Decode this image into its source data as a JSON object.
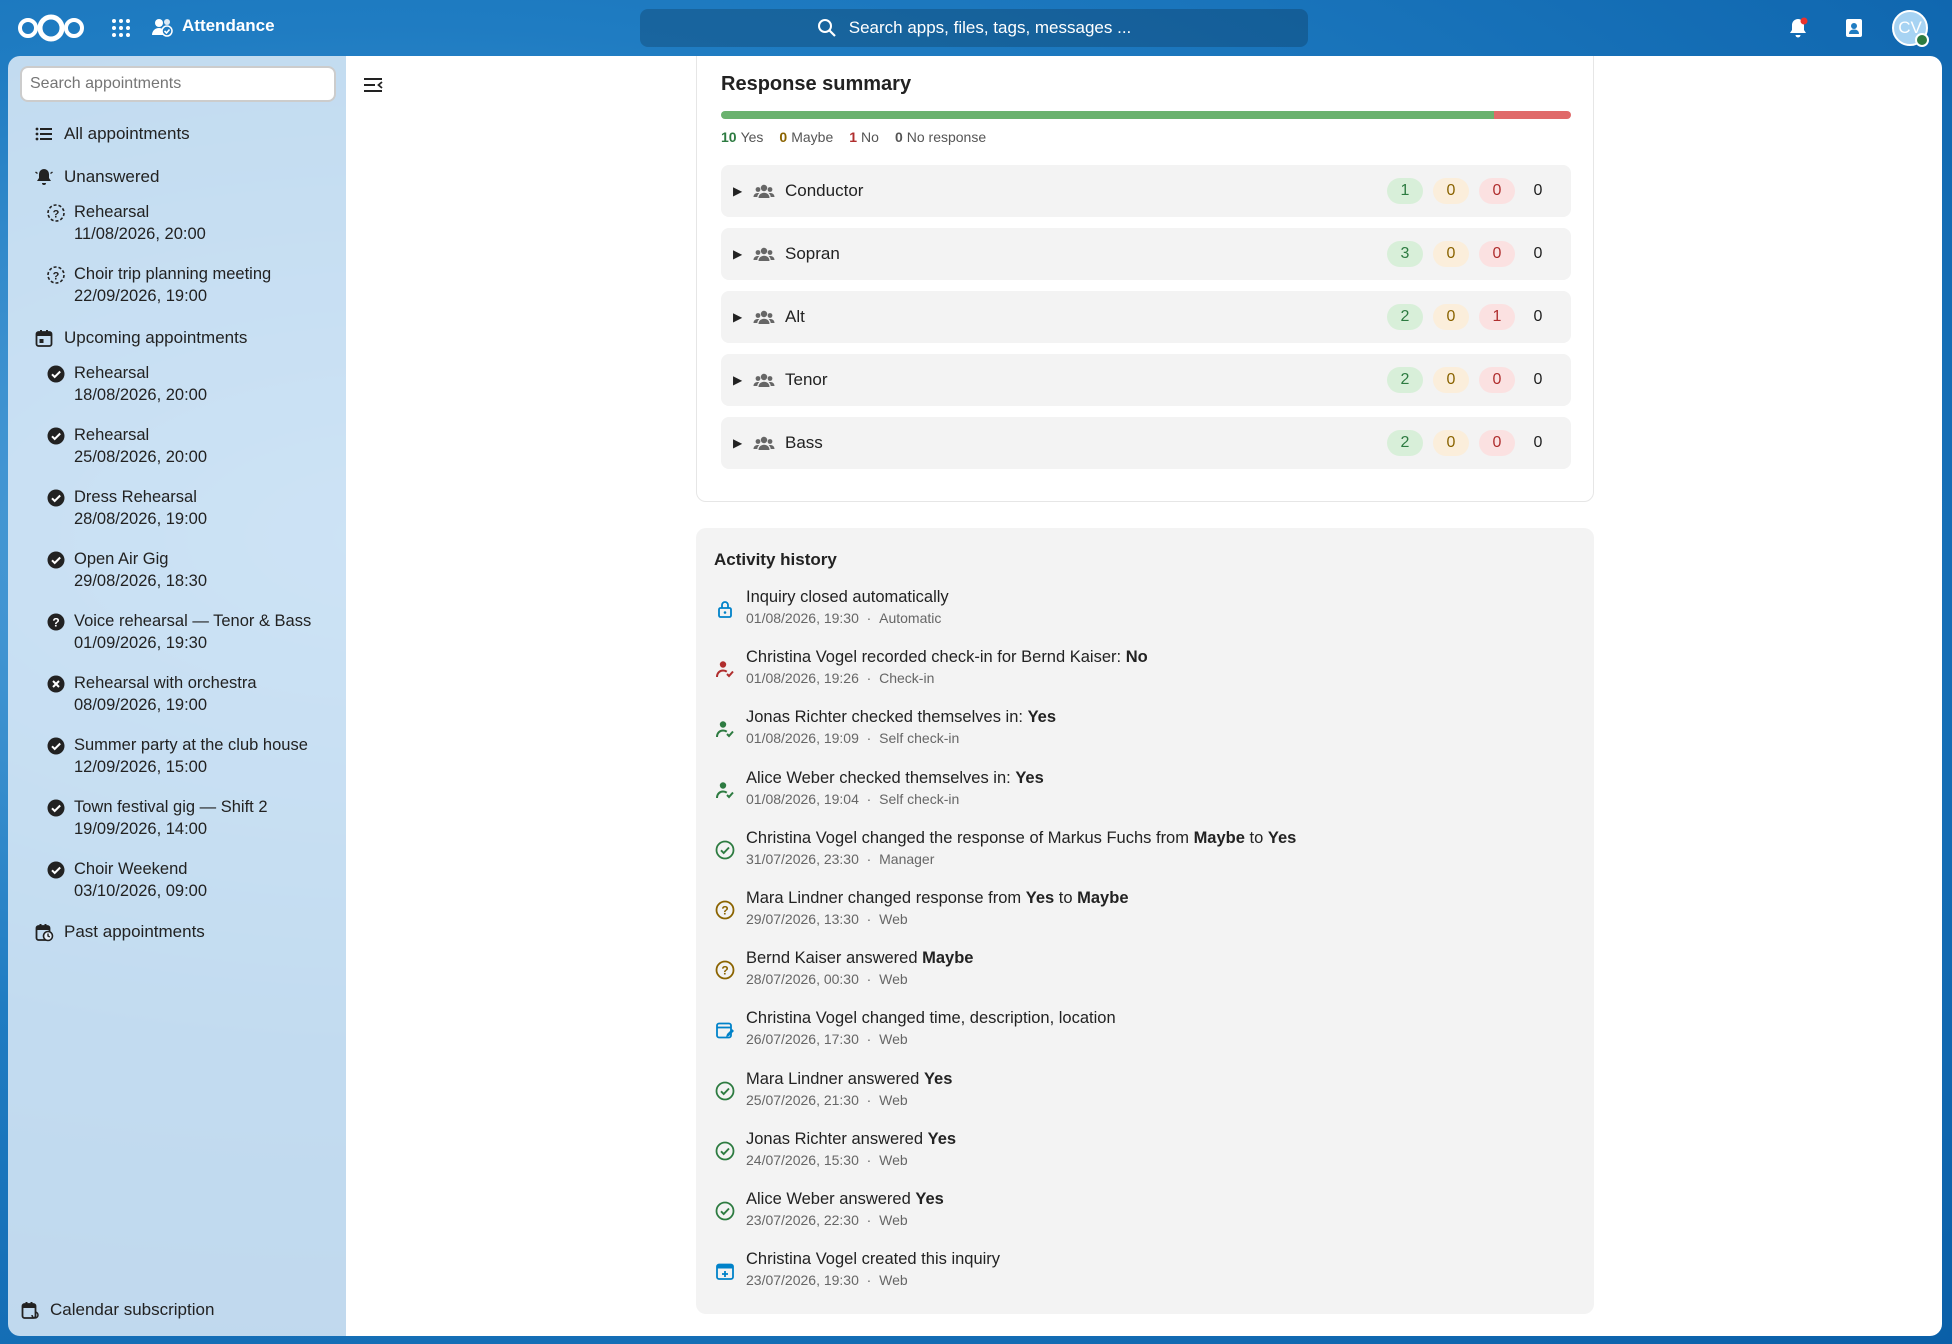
{
  "header": {
    "app_name": "Attendance",
    "search_placeholder": "Search apps, files, tags, messages ...",
    "avatar_initials": "CV"
  },
  "sidebar": {
    "search_placeholder": "Search appointments",
    "all_label": "All appointments",
    "unanswered_label": "Unanswered",
    "unanswered": [
      {
        "title": "Rehearsal",
        "date": "11/08/2026, 20:00"
      },
      {
        "title": "Choir trip planning meeting",
        "date": "22/09/2026, 19:00"
      }
    ],
    "upcoming_label": "Upcoming appointments",
    "upcoming": [
      {
        "title": "Rehearsal",
        "date": "18/08/2026, 20:00",
        "status": "yes"
      },
      {
        "title": "Rehearsal",
        "date": "25/08/2026, 20:00",
        "status": "yes"
      },
      {
        "title": "Dress Rehearsal",
        "date": "28/08/2026, 19:00",
        "status": "yes"
      },
      {
        "title": "Open Air Gig",
        "date": "29/08/2026, 18:30",
        "status": "yes"
      },
      {
        "title": "Voice rehearsal — Tenor & Bass",
        "date": "01/09/2026, 19:30",
        "status": "maybe"
      },
      {
        "title": "Rehearsal with orchestra",
        "date": "08/09/2026, 19:00",
        "status": "no"
      },
      {
        "title": "Summer party at the club house",
        "date": "12/09/2026, 15:00",
        "status": "yes"
      },
      {
        "title": "Town festival gig — Shift 2",
        "date": "19/09/2026, 14:00",
        "status": "yes"
      },
      {
        "title": "Choir Weekend",
        "date": "03/10/2026, 09:00",
        "status": "yes"
      }
    ],
    "past_label": "Past appointments",
    "footer_label": "Calendar subscription"
  },
  "summary": {
    "title": "Response summary",
    "counts": {
      "yes": "10",
      "maybe": "0",
      "no": "1",
      "none": "0"
    },
    "labels": {
      "yes": "Yes",
      "maybe": "Maybe",
      "no": "No",
      "none": "No response"
    },
    "yes_fraction": 0.909,
    "groups": [
      {
        "name": "Conductor",
        "yes": "1",
        "maybe": "0",
        "no": "0",
        "none": "0"
      },
      {
        "name": "Sopran",
        "yes": "3",
        "maybe": "0",
        "no": "0",
        "none": "0"
      },
      {
        "name": "Alt",
        "yes": "2",
        "maybe": "0",
        "no": "1",
        "none": "0"
      },
      {
        "name": "Tenor",
        "yes": "2",
        "maybe": "0",
        "no": "0",
        "none": "0"
      },
      {
        "name": "Bass",
        "yes": "2",
        "maybe": "0",
        "no": "0",
        "none": "0"
      }
    ]
  },
  "activity": {
    "title": "Activity history",
    "items": [
      {
        "icon": "lock-icon",
        "text": "Inquiry closed automatically",
        "bold": "",
        "date": "01/08/2026, 19:30",
        "source": "Automatic"
      },
      {
        "icon": "checkin-no-icon",
        "text": "Christina Vogel recorded check-in for Bernd Kaiser: ",
        "bold": "No",
        "date": "01/08/2026, 19:26",
        "source": "Check-in"
      },
      {
        "icon": "checkin-yes-icon",
        "text": "Jonas Richter checked themselves in: ",
        "bold": "Yes",
        "date": "01/08/2026, 19:09",
        "source": "Self check-in"
      },
      {
        "icon": "checkin-yes-icon",
        "text": "Alice Weber checked themselves in: ",
        "bold": "Yes",
        "date": "01/08/2026, 19:04",
        "source": "Self check-in"
      },
      {
        "icon": "check-circle-icon",
        "text": "Christina Vogel changed the response of Markus Fuchs from ",
        "bold": "Maybe",
        "text2": " to ",
        "bold2": "Yes",
        "date": "31/07/2026, 23:30",
        "source": "Manager"
      },
      {
        "icon": "question-circle-icon",
        "text": "Mara Lindner changed response from ",
        "bold": "Yes",
        "text2": " to ",
        "bold2": "Maybe",
        "date": "29/07/2026, 13:30",
        "source": "Web"
      },
      {
        "icon": "question-circle-icon",
        "text": "Bernd Kaiser answered ",
        "bold": "Maybe",
        "date": "28/07/2026, 00:30",
        "source": "Web"
      },
      {
        "icon": "calendar-edit-icon",
        "text": "Christina Vogel changed time, description, location",
        "bold": "",
        "date": "26/07/2026, 17:30",
        "source": "Web"
      },
      {
        "icon": "check-circle-icon",
        "text": "Mara Lindner answered ",
        "bold": "Yes",
        "date": "25/07/2026, 21:30",
        "source": "Web"
      },
      {
        "icon": "check-circle-icon",
        "text": "Jonas Richter answered ",
        "bold": "Yes",
        "date": "24/07/2026, 15:30",
        "source": "Web"
      },
      {
        "icon": "check-circle-icon",
        "text": "Alice Weber answered ",
        "bold": "Yes",
        "date": "23/07/2026, 22:30",
        "source": "Web"
      },
      {
        "icon": "calendar-plus-icon",
        "text": "Christina Vogel created this inquiry",
        "bold": "",
        "date": "23/07/2026, 19:30",
        "source": "Web"
      }
    ]
  },
  "colors": {
    "yes": "#2d7b41",
    "maybe": "#8a6300",
    "no": "#b02e2e",
    "accent": "#0082c9"
  }
}
